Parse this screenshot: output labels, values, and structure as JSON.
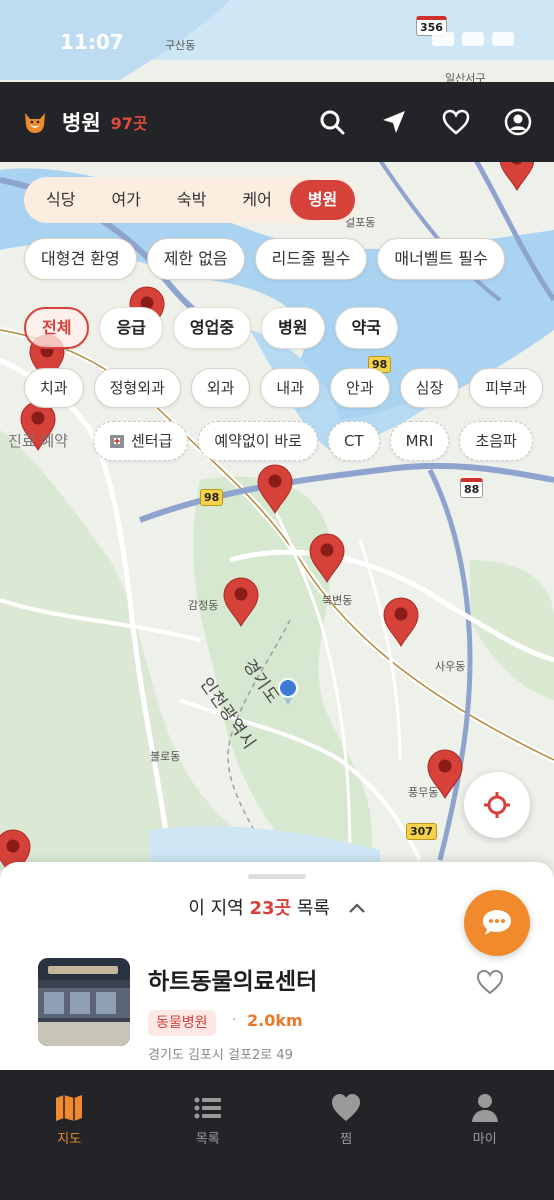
{
  "status_bar": {
    "time": "11:07"
  },
  "header": {
    "title": "병원",
    "count": "97곳"
  },
  "categories": [
    {
      "label": "식당",
      "active": false
    },
    {
      "label": "여가",
      "active": false
    },
    {
      "label": "숙박",
      "active": false
    },
    {
      "label": "케어",
      "active": false
    },
    {
      "label": "병원",
      "active": true
    }
  ],
  "size_filters": [
    "대형견 환영",
    "제한 없음",
    "리드줄 필수",
    "매너벨트 필수"
  ],
  "type_filters": [
    {
      "label": "전체",
      "selected": true
    },
    {
      "label": "응급",
      "selected": false
    },
    {
      "label": "영업중",
      "selected": false
    },
    {
      "label": "병원",
      "selected": false
    },
    {
      "label": "약국",
      "selected": false
    }
  ],
  "dept_filters": [
    "치과",
    "정형외과",
    "외과",
    "내과",
    "안과",
    "심장",
    "피부과"
  ],
  "service_filters": [
    {
      "label": "진료 예약",
      "icon": ""
    },
    {
      "label": "센터급",
      "icon": "hospital-icon"
    },
    {
      "label": "예약없이 바로",
      "icon": ""
    },
    {
      "label": "CT",
      "icon": ""
    },
    {
      "label": "MRI",
      "icon": ""
    },
    {
      "label": "초음파",
      "icon": ""
    }
  ],
  "map": {
    "labels": [
      "구산동",
      "일산서구",
      "걸포동",
      "감정동",
      "북변동",
      "사우동",
      "경기도",
      "인천광역시",
      "불로동",
      "풍무동"
    ],
    "road_numbers": [
      "356",
      "98",
      "98",
      "88",
      "307"
    ]
  },
  "sheet": {
    "title_prefix": "이 지역",
    "title_count": "23곳",
    "title_suffix": "목록",
    "place": {
      "name": "하트동물의료센터",
      "tag": "동물병원",
      "distance": "2.0km",
      "address": "경기도 김포시 걸포2로 49"
    }
  },
  "tabs": [
    {
      "label": "지도",
      "active": true
    },
    {
      "label": "목록",
      "active": false
    },
    {
      "label": "찜",
      "active": false
    },
    {
      "label": "마이",
      "active": false
    }
  ],
  "colors": {
    "accent": "#d6413a",
    "orange": "#f08a2c",
    "header_bg": "#222427"
  }
}
